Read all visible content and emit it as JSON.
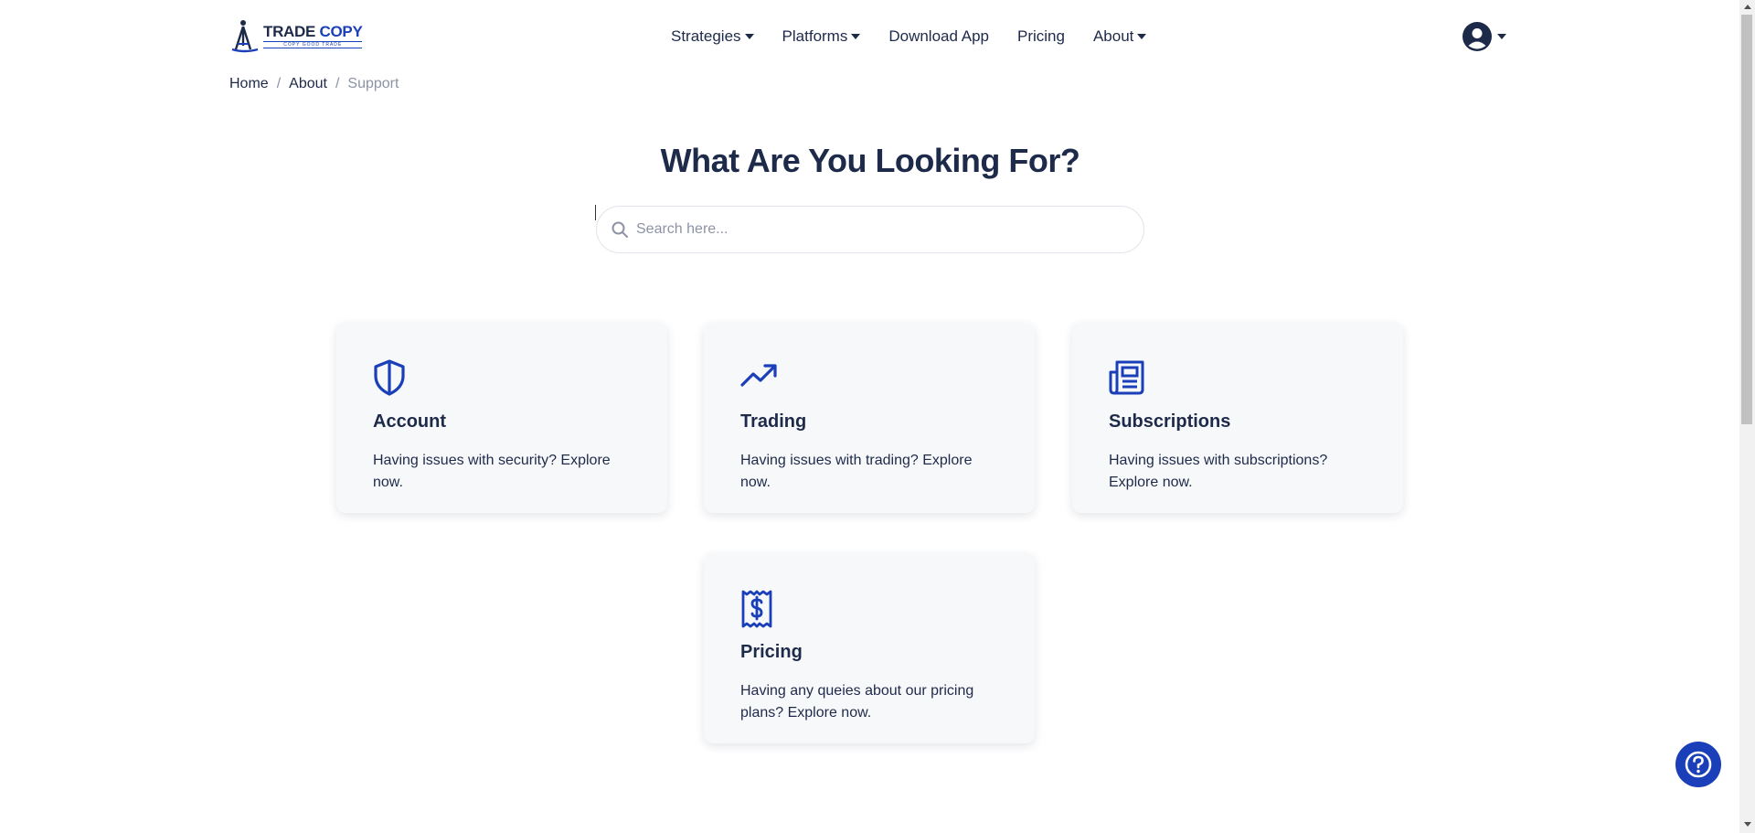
{
  "brand": {
    "name_part1": "TRADE",
    "name_part2": "COPY",
    "tagline": "COPY GOOD TRADE",
    "accent": "#1a3fb8",
    "text_color": "#1e2a4a"
  },
  "nav": {
    "items": [
      {
        "label": "Strategies",
        "dropdown": true
      },
      {
        "label": "Platforms",
        "dropdown": true
      },
      {
        "label": "Download App",
        "dropdown": false
      },
      {
        "label": "Pricing",
        "dropdown": false
      },
      {
        "label": "About",
        "dropdown": true
      }
    ],
    "user_icon": "user-circle-icon"
  },
  "breadcrumb": {
    "items": [
      {
        "label": "Home"
      },
      {
        "label": "About"
      },
      {
        "label": "Support"
      }
    ],
    "separator": "/"
  },
  "hero": {
    "title": "What Are You Looking For?"
  },
  "search": {
    "placeholder": "Search here...",
    "value": "",
    "icon": "search-icon"
  },
  "cards": [
    {
      "title": "Account",
      "description": "Having issues with security? Explore now.",
      "icon": "shield-icon"
    },
    {
      "title": "Trading",
      "description": "Having issues with trading? Explore now.",
      "icon": "trending-up-icon"
    },
    {
      "title": "Subscriptions",
      "description": "Having issues with subscriptions? Explore now.",
      "icon": "newspaper-icon"
    },
    {
      "title": "Pricing",
      "description": "Having any queies about our pricing plans? Explore now.",
      "icon": "receipt-dollar-icon"
    }
  ],
  "help_button": {
    "icon": "question-circle-icon"
  }
}
